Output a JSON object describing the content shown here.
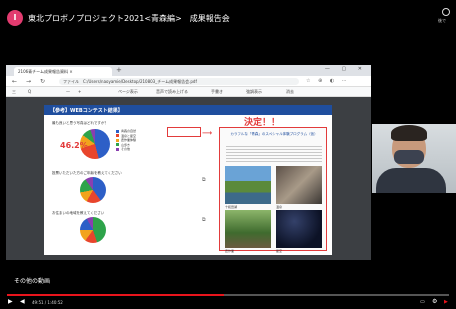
{
  "header": {
    "channel_initial": "I",
    "video_title": "東北プロボノプロジェクト2021<青森編>　成果報告会",
    "top_right_label": "後で"
  },
  "browser": {
    "tab_title": "2106青チーム成果報告資料 ×",
    "url": "ファイル　C:/Users/naoyamie/Desktop/210803_チーム成果報告会.pdf",
    "toolbar_items": [
      "三",
      "Q",
      "—",
      "+",
      "ページ表示",
      "音声で読み上げる",
      "手書き",
      "強調表示",
      "消去"
    ]
  },
  "slide": {
    "header_title": "【参考】WEBコンテスト結果】",
    "pie1_caption": "最も良いと思う写真はどれですか？",
    "pie1_pct": "46.2%",
    "pie2_caption": "投票いただいた方のご年齢を教えてください",
    "pie3_caption": "お住まいの地域を教えてください",
    "legend_items": [
      "青森の自然",
      "温泉と星空",
      "農作業体験",
      "山歩き",
      "その他"
    ],
    "decision_label": "決定！！",
    "panel_title": "カラフルな「青森」のスペシャル体験プログラム（仮）",
    "photo_captions": [
      "十和田湖",
      "温泉",
      "農作業",
      "星空"
    ]
  },
  "colors": {
    "accent_red": "#e23b3b",
    "header_blue": "#1f4e9e",
    "progress_red": "#e8141c"
  },
  "player": {
    "other_videos_label": "その他の動画",
    "time_display": "49:51 / 1:40:52",
    "progress_fraction": 0.49
  },
  "icons": {
    "play": "play-icon",
    "volume": "volume-icon",
    "subtitles": "subtitles-icon",
    "settings": "settings-icon",
    "youtube": "youtube-logo-icon"
  }
}
